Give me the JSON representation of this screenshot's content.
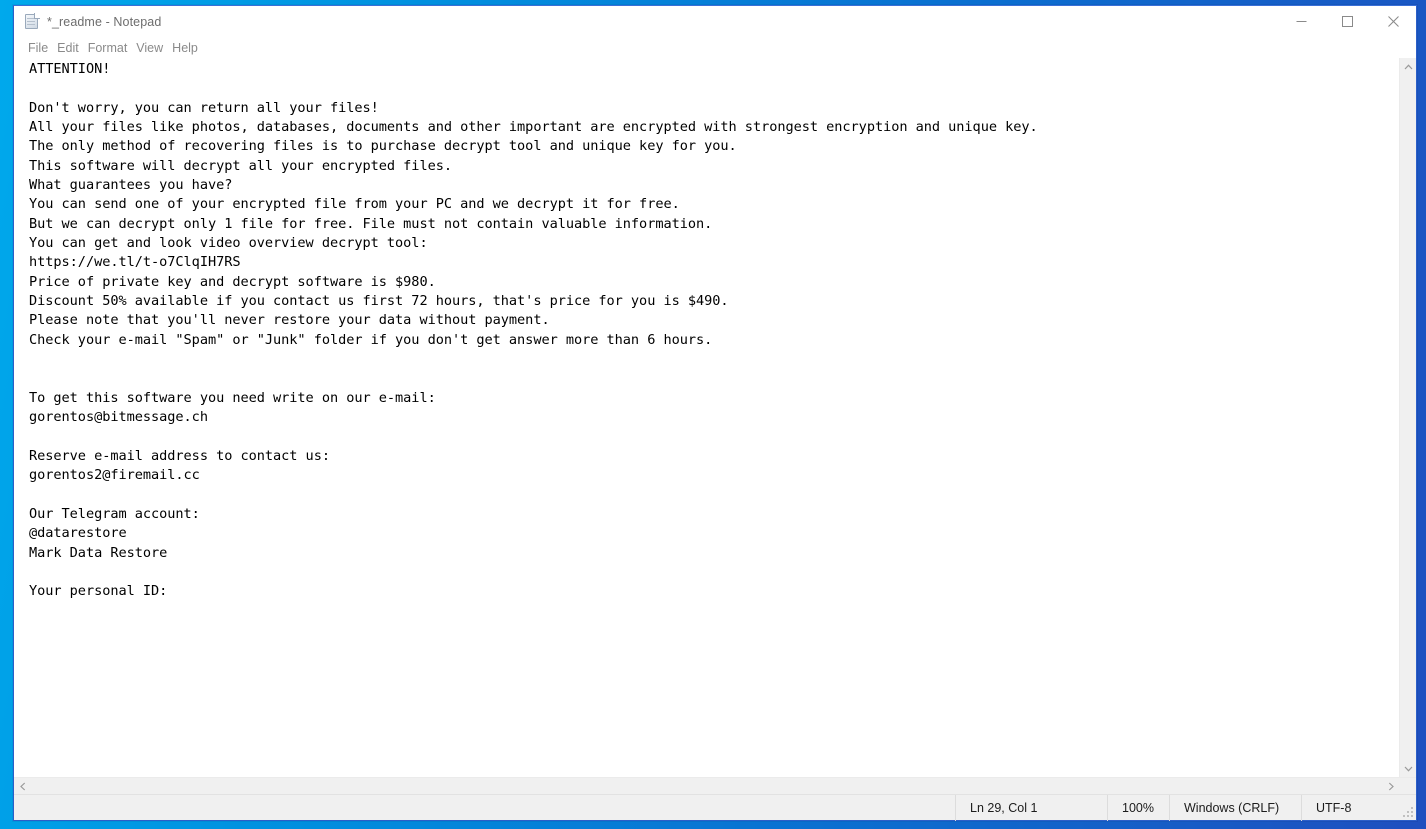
{
  "window": {
    "title": "*_readme - Notepad",
    "icon": "notepad-icon",
    "controls": {
      "minimize": "minimize",
      "maximize": "maximize",
      "close": "close"
    }
  },
  "menu": {
    "items": [
      {
        "label": "File"
      },
      {
        "label": "Edit"
      },
      {
        "label": "Format"
      },
      {
        "label": "View"
      },
      {
        "label": "Help"
      }
    ]
  },
  "document": {
    "body": "ATTENTION!\n\nDon't worry, you can return all your files!\nAll your files like photos, databases, documents and other important are encrypted with strongest encryption and unique key.\nThe only method of recovering files is to purchase decrypt tool and unique key for you.\nThis software will decrypt all your encrypted files.\nWhat guarantees you have?\nYou can send one of your encrypted file from your PC and we decrypt it for free.\nBut we can decrypt only 1 file for free. File must not contain valuable information.\nYou can get and look video overview decrypt tool:\nhttps://we.tl/t-o7ClqIH7RS\nPrice of private key and decrypt software is $980.\nDiscount 50% available if you contact us first 72 hours, that's price for you is $490.\nPlease note that you'll never restore your data without payment.\nCheck your e-mail \"Spam\" or \"Junk\" folder if you don't get answer more than 6 hours.\n\n\nTo get this software you need write on our e-mail:\ngorentos@bitmessage.ch\n\nReserve e-mail address to contact us:\ngorentos2@firemail.cc\n\nOur Telegram account:\n@datarestore\nMark Data Restore\n\nYour personal ID:"
  },
  "status_bar": {
    "cursor_position": "Ln 29, Col 1",
    "zoom": "100%",
    "line_ending": "Windows (CRLF)",
    "encoding": "UTF-8"
  },
  "scrollbars": {
    "vertical_up": "scroll-up",
    "vertical_down": "scroll-down",
    "horizontal_left": "scroll-left",
    "horizontal_right": "scroll-right"
  },
  "colors": {
    "desktop_gradient_start": "#00a9ec",
    "desktop_gradient_end": "#1f4fbf",
    "window_background": "#ffffff",
    "chrome_background": "#f0f0f0",
    "text": "#000000",
    "muted_text": "#8a8a8a"
  }
}
